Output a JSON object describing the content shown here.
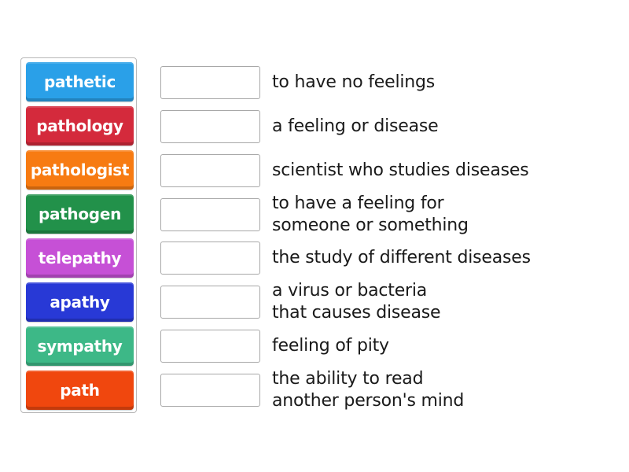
{
  "tiles": [
    {
      "label": "pathetic",
      "color": "#2aa0e8"
    },
    {
      "label": "pathology",
      "color": "#d42a3c"
    },
    {
      "label": "pathologist",
      "color": "#f77b12"
    },
    {
      "label": "pathogen",
      "color": "#22914a"
    },
    {
      "label": "telepathy",
      "color": "#c650d6"
    },
    {
      "label": "apathy",
      "color": "#2839d6"
    },
    {
      "label": "sympathy",
      "color": "#3db887"
    },
    {
      "label": "path",
      "color": "#f0470e"
    }
  ],
  "definitions": [
    {
      "text": "to have no feelings",
      "answer": ""
    },
    {
      "text": "a feeling or disease",
      "answer": ""
    },
    {
      "text": "scientist who studies diseases",
      "answer": ""
    },
    {
      "text": "to have a feeling for\nsomeone or something",
      "answer": ""
    },
    {
      "text": "the study of different diseases",
      "answer": ""
    },
    {
      "text": "a virus or bacteria\nthat causes disease",
      "answer": ""
    },
    {
      "text": "feeling of pity",
      "answer": ""
    },
    {
      "text": "the ability to read\nanother person's mind",
      "answer": ""
    }
  ]
}
